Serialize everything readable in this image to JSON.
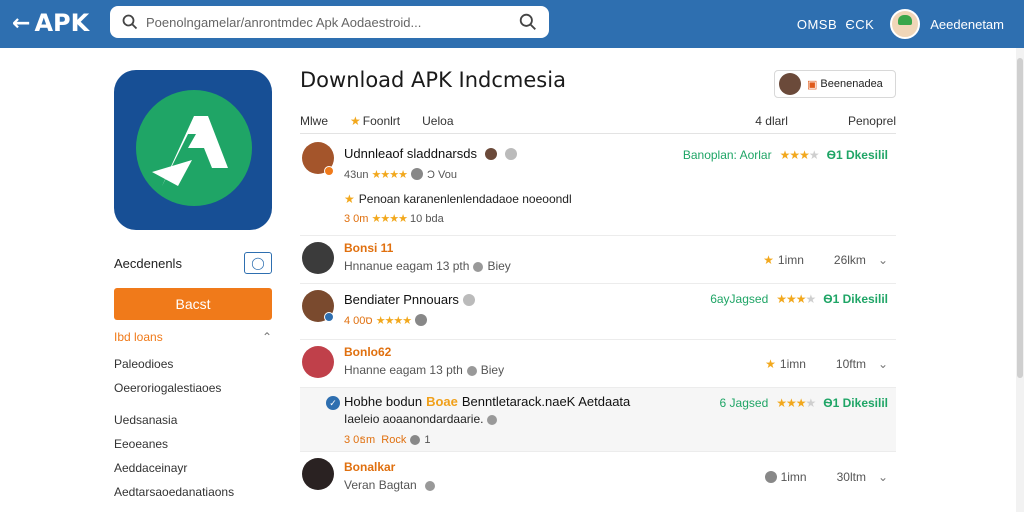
{
  "header": {
    "brand": "APK",
    "search_text": "Poenolngamelar/anrontmdec Apk Aodaestroid...",
    "lang": "OMSB",
    "lang2": "ЄCK",
    "username": "Aeedenetam"
  },
  "sidebar": {
    "label": "Aecdenenls",
    "install_label": "Bacst",
    "categories_title": "Ibd loans",
    "categories": [
      "Paleodioes",
      "Oeeroriogalestiaoes",
      "Uedsanasia",
      "Eeoeanes",
      "Aeddaceinayr",
      "Aedtarsaoedanatiaons"
    ]
  },
  "main": {
    "title": "Download APK Indcmesia",
    "user_chip": "Beenenadea",
    "tabs": [
      "Mlwe",
      "Foonlrt",
      "Ueloa"
    ],
    "tab_right": [
      "4 dlarl",
      "Penoprel"
    ],
    "reviews": [
      {
        "name": "Udnnleaof sladdnarsds",
        "sub1": "43un",
        "sub2": "Ͻ Vou",
        "text": "Penoan karanenlenlendadaoe noeoondl",
        "sub3": "3 0m",
        "sub4": "10 bda",
        "right_label": "Banoplan: Aorlar",
        "download": "Ѳ1 Dkesilil"
      },
      {
        "name": "Bonsi 11",
        "sub1": "Hnnanue eagam 13 pth",
        "sub2": "Biey",
        "right_time": "1imn",
        "right_count": "26lkm"
      },
      {
        "name": "Bendiater Pnnouars",
        "sub1": "4 00ס",
        "right_label": "6ayJagsed",
        "download": "Ѳ1 Dikesilil"
      },
      {
        "name": "Bonlo62",
        "sub1": "Hnanne eagam 13 pth",
        "sub2": "Biey",
        "right_time": "1imn",
        "right_count": "10ftm"
      },
      {
        "name": "Hobhe bodun",
        "tag": "Boae",
        "name2": "Benntletarack.naeK Aetdaata",
        "line2": "Iaeleio aoaanondardaarie.",
        "sub1": "3 0ธm",
        "sub2": "Rock",
        "sub3": "1",
        "right_label": "6 Jagsed",
        "download": "Ѳ1 Dikesilil"
      },
      {
        "name": "Bonalkar",
        "sub1": "Veran Bagtan",
        "right_time": "1imn",
        "right_count": "30ltm"
      }
    ]
  },
  "colors": {
    "topbar": "#2e6fb0",
    "accent_orange": "#f07a1a",
    "accent_green": "#1fa566",
    "star": "#f2a81d"
  }
}
